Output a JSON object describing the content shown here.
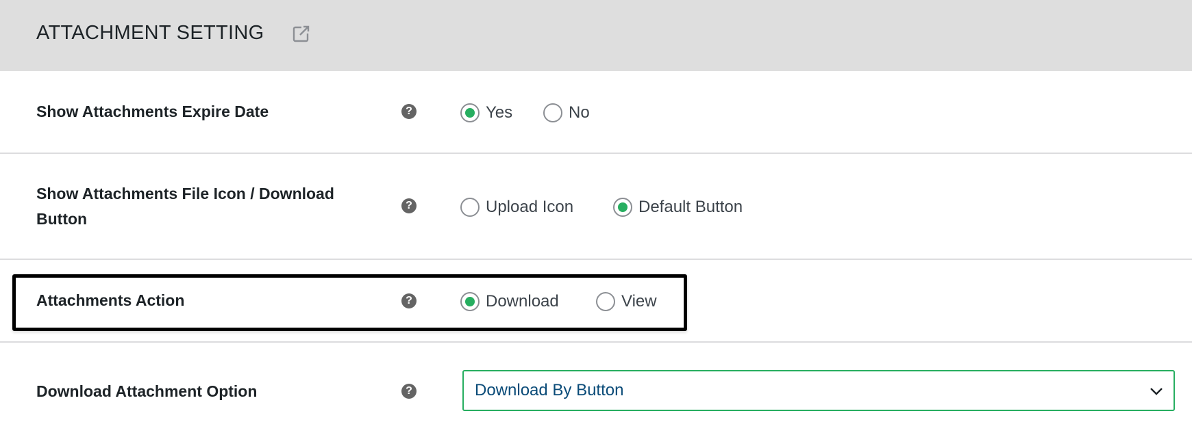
{
  "header": {
    "title": "ATTACHMENT SETTING",
    "icon": "external-link-icon"
  },
  "settings": [
    {
      "label": "Show Attachments Expire Date",
      "help": "?",
      "options": [
        "Yes",
        "No"
      ],
      "selected": "Yes"
    },
    {
      "label": "Show Attachments File Icon / Download Button",
      "help": "?",
      "options": [
        "Upload Icon",
        "Default Button"
      ],
      "selected": "Default Button"
    },
    {
      "label": "Attachments Action",
      "help": "?",
      "options": [
        "Download",
        "View"
      ],
      "selected": "Download"
    },
    {
      "label": "Download Attachment Option",
      "help": "?",
      "select_value": "Download By Button"
    }
  ],
  "colors": {
    "accent": "#27ae60",
    "header_bg": "#dedede",
    "select_text": "#0a4b78"
  }
}
